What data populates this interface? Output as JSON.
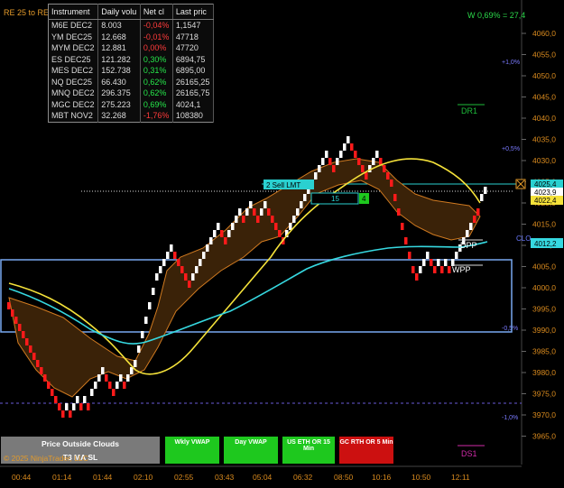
{
  "title": "RE 25 to RE",
  "watch": "W 0,69% = 27,4",
  "table": {
    "headers": [
      "Instrument",
      "Daily volu",
      "Net cl",
      "Last pric"
    ],
    "rows": [
      {
        "inst": "M6E DEC2",
        "vol": "8.003",
        "net": "-0,04%",
        "last": "1,1547",
        "sign": "neg"
      },
      {
        "inst": "YM DEC25",
        "vol": "12.668",
        "net": "-0,01%",
        "last": "47718",
        "sign": "neg"
      },
      {
        "inst": "MYM DEC2",
        "vol": "12.881",
        "net": "0,00%",
        "last": "47720",
        "sign": "neg"
      },
      {
        "inst": "ES DEC25",
        "vol": "121.282",
        "net": "0,30%",
        "last": "6894,75",
        "sign": "pos"
      },
      {
        "inst": "MES DEC2",
        "vol": "152.738",
        "net": "0,31%",
        "last": "6895,00",
        "sign": "pos"
      },
      {
        "inst": "NQ DEC25",
        "vol": "66.430",
        "net": "0,62%",
        "last": "26165,25",
        "sign": "pos"
      },
      {
        "inst": "MNQ DEC2",
        "vol": "296.375",
        "net": "0,62%",
        "last": "26165,75",
        "sign": "pos"
      },
      {
        "inst": "MGC DEC2",
        "vol": "275.223",
        "net": "0,69%",
        "last": "4024,1",
        "sign": "pos"
      },
      {
        "inst": "MBT NOV2",
        "vol": "32.268",
        "net": "-1,76%",
        "last": "108380",
        "sign": "neg"
      }
    ]
  },
  "price_axis": [
    "4060,0",
    "4055,0",
    "4050,0",
    "4045,0",
    "4040,0",
    "4035,0",
    "4030,0",
    "4025,0",
    "4020,0",
    "4015,0",
    "4010,0",
    "4005,0",
    "4000,0",
    "3995,0",
    "3990,0",
    "3985,0",
    "3980,0",
    "3975,0",
    "3970,0",
    "3965,0"
  ],
  "time_axis": [
    "00:44",
    "01:14",
    "01:44",
    "02:10",
    "02:55",
    "03:43",
    "05:04",
    "06:32",
    "08:50",
    "10:16",
    "10:50",
    "12:11"
  ],
  "pct_labels": [
    "+1,0%",
    "+0,5%",
    "-0,5%",
    "-1,0%"
  ],
  "levels": {
    "dr1": "DR1",
    "ds1": "DS1",
    "dpp": "DPP",
    "wpp": "WPP",
    "clo": "CLO"
  },
  "price_tags": {
    "top": "4025,4",
    "mid": "4023,9",
    "low": "4022,4",
    "cyan": "4012,2"
  },
  "order": {
    "label": "2 Sell LMT",
    "qty": "15",
    "stop": "4"
  },
  "buttons": {
    "price_outside": "Price Outside Clouds",
    "t3": "T3 MA SL",
    "wkly": "Wkly VWAP",
    "day": "Day VWAP",
    "us_eth": "US ETH OR 15 Min",
    "gc_rth": "GC RTH OR 5 Min"
  },
  "copyright": "© 2025 NinjaTrader, LLC",
  "colors": {
    "up": "#ffffff",
    "down": "#ff1a1a",
    "t3": "#f5e23a",
    "vwap": "#36d8e0",
    "cloud": "#3a2208",
    "button_green": "#1ec81e",
    "button_red": "#cc1010"
  }
}
